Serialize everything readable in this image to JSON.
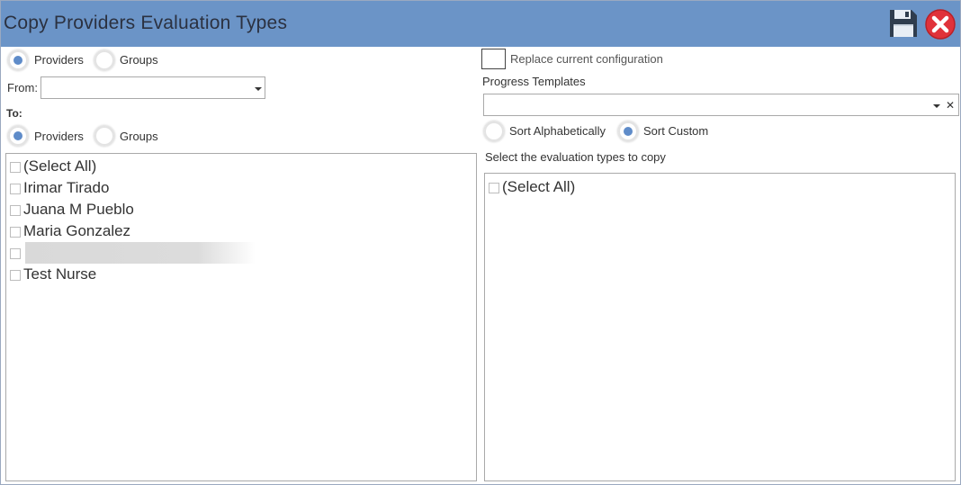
{
  "window": {
    "title": "Copy Providers Evaluation Types"
  },
  "toolbar": {
    "save_icon": "floppy-disk-icon",
    "close_icon": "close-circle-icon"
  },
  "source": {
    "type_radio": {
      "providers": "Providers",
      "groups": "Groups",
      "selected": "providers"
    },
    "from_label": "From:",
    "from_value": ""
  },
  "target": {
    "to_label": "To:",
    "type_radio": {
      "providers": "Providers",
      "groups": "Groups",
      "selected": "providers"
    },
    "list": [
      {
        "label": "(Select All)",
        "checked": false
      },
      {
        "label": "Irimar Tirado",
        "checked": false
      },
      {
        "label": "Juana M Pueblo",
        "checked": false
      },
      {
        "label": "Maria Gonzalez",
        "checked": false
      },
      {
        "label": "",
        "checked": false,
        "redacted": true
      },
      {
        "label": "Test Nurse",
        "checked": false
      }
    ]
  },
  "options": {
    "replace_label": "Replace current configuration",
    "replace_checked": false,
    "templates_label": "Progress Templates",
    "templates_value": "",
    "sort": {
      "alpha": "Sort Alphabetically",
      "custom": "Sort Custom",
      "selected": "custom"
    },
    "eval_label": "Select the evaluation types to copy",
    "eval_list": [
      {
        "label": "(Select All)",
        "checked": false
      }
    ]
  },
  "colors": {
    "titlebar": "#6b94c7",
    "radio_selected": "#5f8cc9",
    "close_red": "#e0323a"
  }
}
